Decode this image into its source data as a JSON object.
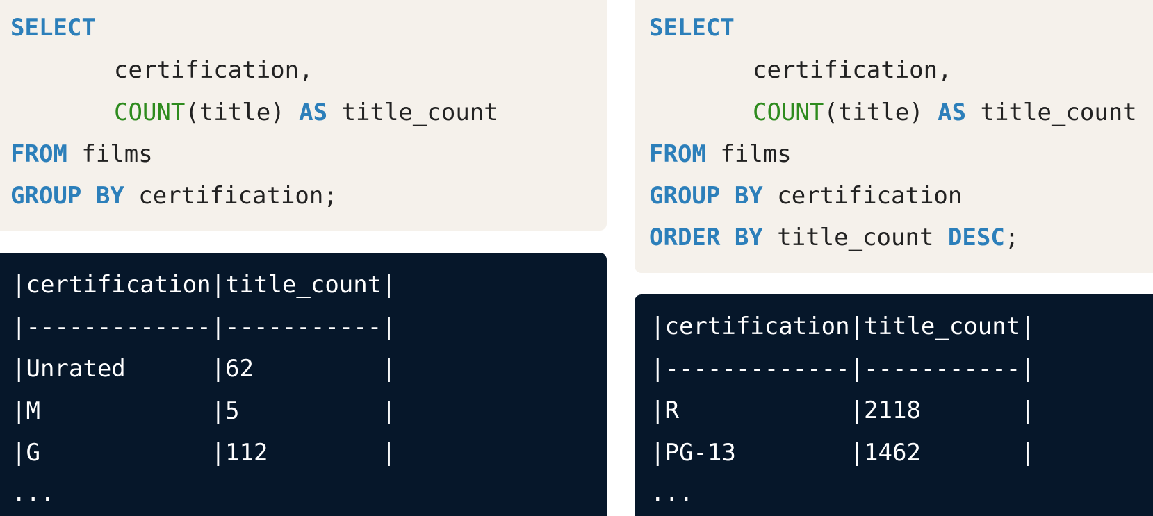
{
  "left_panel": {
    "query": {
      "kw_select": "SELECT",
      "col_certification": "certification,",
      "fn_count": "COUNT",
      "count_args": "(title)",
      "kw_as": "AS",
      "alias_title_count": "title_count",
      "kw_from": "FROM",
      "table_films": "films",
      "kw_group_by": "GROUP BY",
      "group_col": "certification;"
    },
    "output": {
      "header": "|certification|title_count|",
      "separator": "|-------------|-----------|",
      "rows": [
        "|Unrated      |62         |",
        "|M            |5          |",
        "|G            |112        |"
      ],
      "ellipsis": "..."
    }
  },
  "right_panel": {
    "query": {
      "kw_select": "SELECT",
      "col_certification": "certification,",
      "fn_count": "COUNT",
      "count_args": "(title)",
      "kw_as": "AS",
      "alias_title_count": "title_count",
      "kw_from": "FROM",
      "table_films": "films",
      "kw_group_by": "GROUP BY",
      "group_col": "certification",
      "kw_order_by": "ORDER BY",
      "order_col": "title_count",
      "kw_desc": "DESC",
      "semicolon": ";"
    },
    "output": {
      "header": "|certification|title_count|",
      "separator": "|-------------|-----------|",
      "rows": [
        "|R            |2118       |",
        "|PG-13        |1462       |"
      ],
      "ellipsis": "..."
    }
  },
  "colors": {
    "code_background": "#f5f1eb",
    "output_background": "#06172a",
    "keyword": "#2c7fba",
    "function": "#2e8b1e",
    "text": "#222222",
    "output_text": "#ffffff"
  }
}
